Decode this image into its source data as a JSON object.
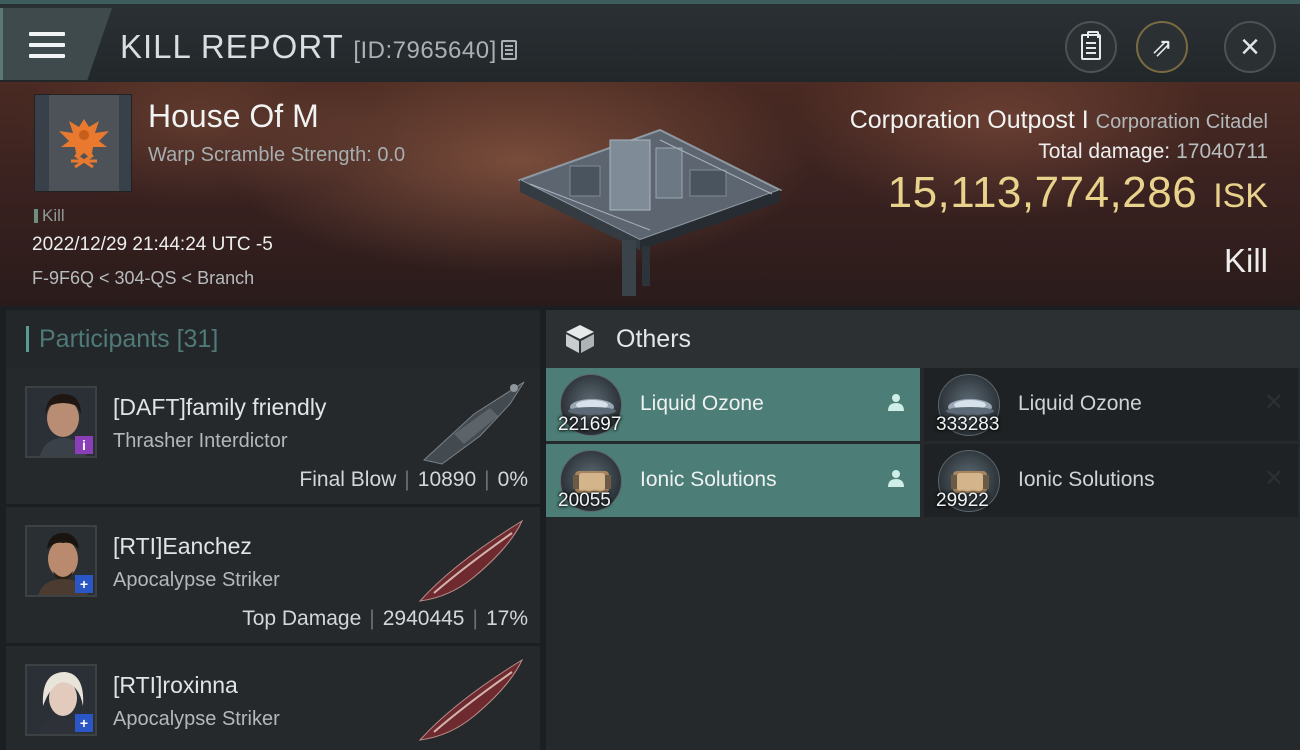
{
  "header": {
    "title": "KILL REPORT",
    "report_id": "[ID:7965640]",
    "menu_icon": "hamburger-menu-icon",
    "buttons": [
      {
        "name": "clipboard-icon"
      },
      {
        "name": "share-icon"
      },
      {
        "name": "close-icon"
      }
    ]
  },
  "victim": {
    "name": "House Of M",
    "warp_scramble": "Warp Scramble Strength: 0.0",
    "tag": "Kill",
    "timestamp": "2022/12/29 21:44:24 UTC -5",
    "location": "F-9F6Q < 304-QS < Branch",
    "ship_type": "Corporation Outpost",
    "ship_class": "Corporation Citadel",
    "separator": "I",
    "total_damage_label": "Total damage:",
    "total_damage": "17040711",
    "isk_value": "15,113,774,286",
    "isk_unit": "ISK",
    "result": "Kill"
  },
  "participants": {
    "title": "Participants",
    "count": "[31]",
    "items": [
      {
        "name": "[DAFT]family friendly",
        "ship": "Thrasher Interdictor",
        "stat_label": "Final Blow",
        "damage": "10890",
        "percent": "0%",
        "badge": "i"
      },
      {
        "name": "[RTI]Eanchez",
        "ship": "Apocalypse Striker",
        "stat_label": "Top Damage",
        "damage": "2940445",
        "percent": "17%",
        "badge": "+"
      },
      {
        "name": "[RTI]roxinna",
        "ship": "Apocalypse Striker",
        "badge": "+"
      }
    ]
  },
  "others": {
    "title": "Others",
    "items": [
      {
        "name": "Liquid Ozone",
        "qty": "221697",
        "state": "selected",
        "flag": "person-icon"
      },
      {
        "name": "Liquid Ozone",
        "qty": "333283",
        "state": "destroyed",
        "flag": "x-icon"
      },
      {
        "name": "Ionic Solutions",
        "qty": "20055",
        "state": "selected",
        "flag": "person-icon"
      },
      {
        "name": "Ionic Solutions",
        "qty": "29922",
        "state": "destroyed",
        "flag": "x-icon"
      }
    ]
  },
  "colors": {
    "accent": "#4c7d76",
    "isk": "#e9d38c",
    "badge_purple": "#8a3fb8",
    "badge_blue": "#2a56c6"
  }
}
